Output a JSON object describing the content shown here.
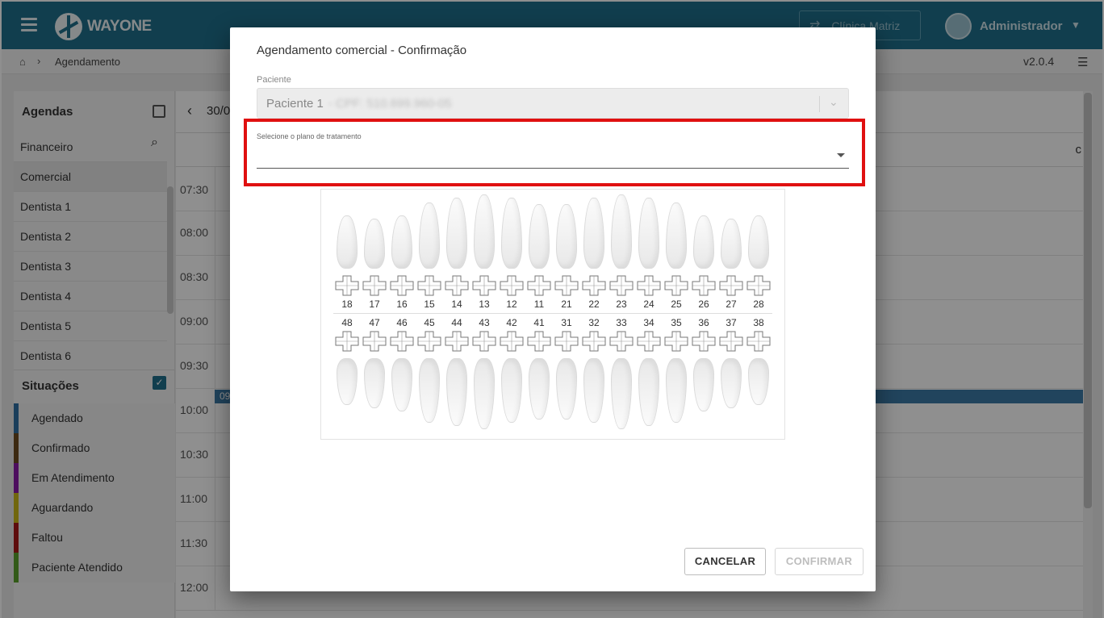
{
  "header": {
    "logo_text": "WAYONE",
    "clinic_button": "Clínica Matriz",
    "user_name": "Administrador"
  },
  "breadcrumb": {
    "current": "Agendamento",
    "version": "v2.0.4"
  },
  "sidebar": {
    "agendas_title": "Agendas",
    "agendas": [
      "Financeiro",
      "Comercial",
      "Dentista 1",
      "Dentista 2",
      "Dentista 3",
      "Dentista 4",
      "Dentista 5",
      "Dentista 6"
    ],
    "situacoes_title": "Situações",
    "situacoes": [
      {
        "label": "Agendado",
        "color": "#2f6fa3"
      },
      {
        "label": "Confirmado",
        "color": "#6b4a1f"
      },
      {
        "label": "Em Atendimento",
        "color": "#8a1aa8"
      },
      {
        "label": "Aguardando",
        "color": "#c9b81a"
      },
      {
        "label": "Faltou",
        "color": "#a81818"
      },
      {
        "label": "Paciente Atendido",
        "color": "#5aa02c"
      }
    ]
  },
  "calendar": {
    "date": "30/0",
    "col_letter": "c",
    "times": [
      "07:30",
      "08:00",
      "08:30",
      "09:00",
      "09:30",
      "10:00",
      "10:30",
      "11:00",
      "11:30",
      "12:00"
    ],
    "appt_label": "09"
  },
  "modal": {
    "title": "Agendamento comercial - Confirmação",
    "patient_label": "Paciente",
    "patient_value": "Paciente 1",
    "patient_blurred": "- CPF: 510.699.960-05",
    "plan_label": "Selecione o plano de tratamento",
    "plan_value": "",
    "upper_teeth": [
      "18",
      "17",
      "16",
      "15",
      "14",
      "13",
      "12",
      "11",
      "21",
      "22",
      "23",
      "24",
      "25",
      "26",
      "27",
      "28"
    ],
    "lower_teeth": [
      "48",
      "47",
      "46",
      "45",
      "44",
      "43",
      "42",
      "41",
      "31",
      "32",
      "33",
      "34",
      "35",
      "36",
      "37",
      "38"
    ],
    "cancel_label": "CANCELAR",
    "confirm_label": "CONFIRMAR"
  },
  "colors": {
    "brand": "#1f6f8b",
    "highlight": "#e01010"
  },
  "icons": [
    "menu-icon",
    "home-icon",
    "list-icon",
    "search-icon",
    "chevron-down-icon",
    "caret-down-icon",
    "back-icon",
    "shuffle-icon"
  ]
}
